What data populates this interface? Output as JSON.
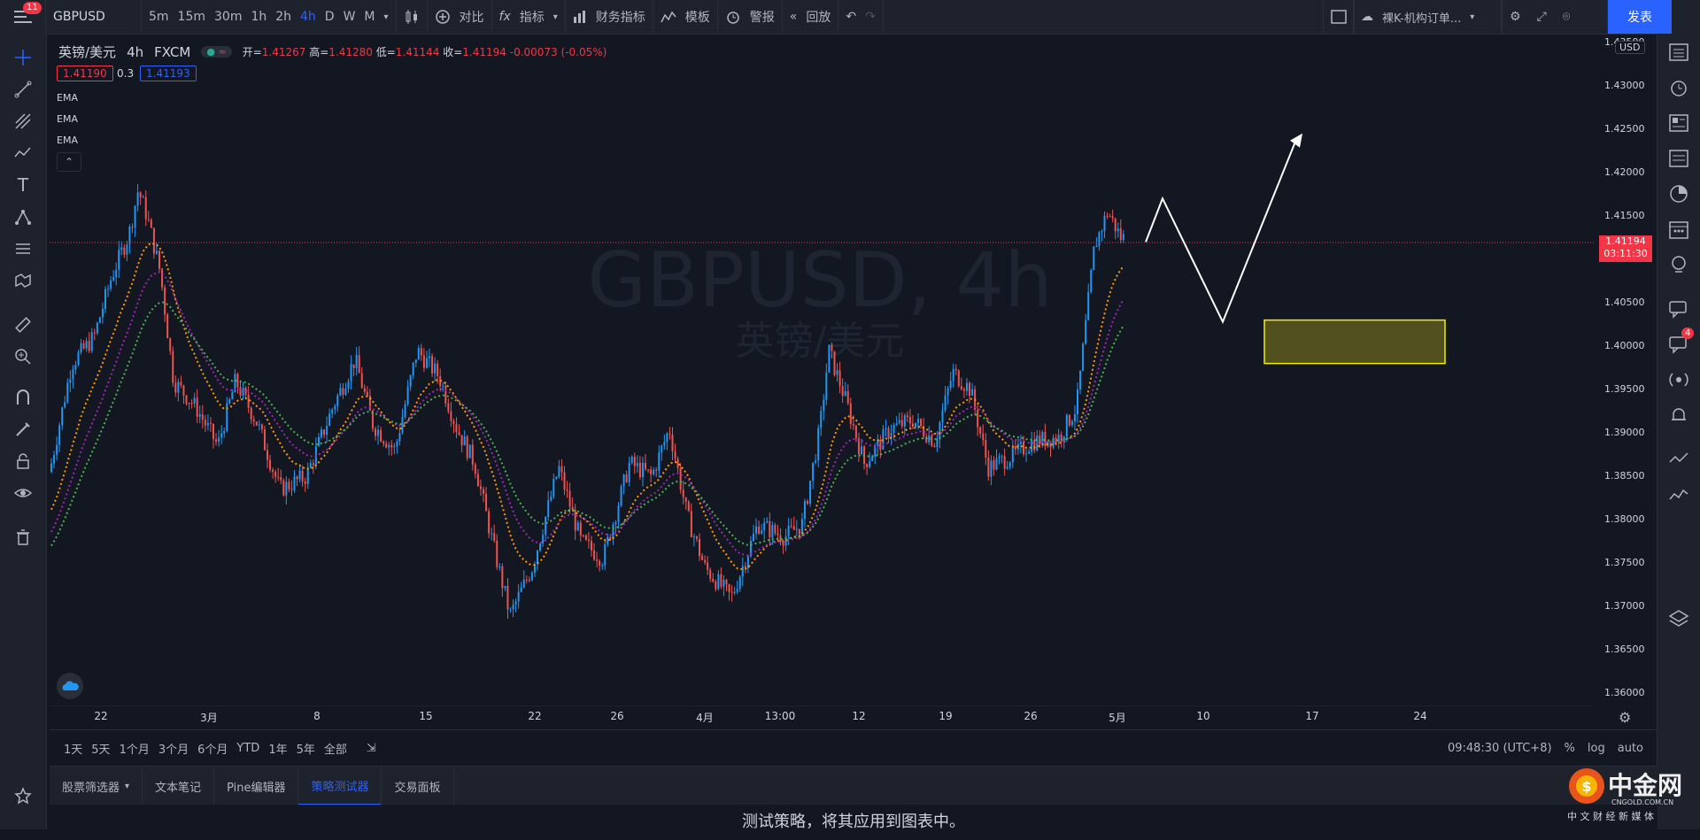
{
  "toolbar": {
    "menu_badge": "11",
    "symbol": "GBPUSD",
    "intervals": [
      "5m",
      "15m",
      "30m",
      "1h",
      "2h",
      "4h",
      "D",
      "W",
      "M"
    ],
    "active_interval": "4h",
    "compare_label": "对比",
    "indicators_label": "指标",
    "financials_label": "财务指标",
    "templates_label": "模板",
    "alert_label": "警报",
    "replay_label": "回放",
    "layout_name": "裸K-机构订单...",
    "publish_label": "发表"
  },
  "legend": {
    "pair_name": "英镑/美元",
    "interval": "4h",
    "broker": "FXCM",
    "open_label": "开=",
    "open": "1.41267",
    "high_label": "高=",
    "high": "1.41280",
    "low_label": "低=",
    "low": "1.41144",
    "close_label": "收=",
    "close": "1.41194",
    "change": "-0.00073 (-0.05%)",
    "bid": "1.41190",
    "spread": "0.3",
    "ask": "1.41193",
    "ema_labels": [
      "EMA",
      "EMA",
      "EMA"
    ]
  },
  "watermark": {
    "title": "GBPUSD, 4h",
    "subtitle": "英镑/美元"
  },
  "price_axis": {
    "currency": "USD",
    "labels": [
      "1.43500",
      "1.43000",
      "1.42500",
      "1.42000",
      "1.41500",
      "1.41000",
      "1.40500",
      "1.40000",
      "1.39500",
      "1.39000",
      "1.38500",
      "1.38000",
      "1.37500",
      "1.37000",
      "1.36500",
      "1.36000"
    ],
    "last_price": "1.41194",
    "countdown": "03:11:30"
  },
  "time_axis": {
    "labels": [
      "22",
      "3月",
      "8",
      "15",
      "22",
      "26",
      "4月",
      "13:00",
      "12",
      "19",
      "26",
      "5月",
      "10",
      "17",
      "24"
    ]
  },
  "range_bar": {
    "ranges": [
      "1天",
      "5天",
      "1个月",
      "3个月",
      "6个月",
      "YTD",
      "1年",
      "5年",
      "全部"
    ],
    "clock": "09:48:30 (UTC+8)",
    "percent_label": "%",
    "log_label": "log",
    "auto_label": "auto"
  },
  "bottom_tabs": {
    "tabs": [
      "股票筛选器",
      "文本笔记",
      "Pine编辑器",
      "策略测试器",
      "交易面板"
    ],
    "active": "策略测试器",
    "message": "测试策略，将其应用到图表中。"
  },
  "right_panel": {
    "chat_badge": "4"
  },
  "brand": {
    "name": "中金网",
    "domain": "CNGOLD.COM.CN",
    "slogan": "中 文 财 经 新 媒 体"
  },
  "colors": {
    "bg": "#131722",
    "up": "#2196f3",
    "down": "#ef5350",
    "ema_fast": "#ff9800",
    "ema_mid": "#9c27b0",
    "ema_slow": "#4caf50",
    "zone_fill": "#5f5a1e",
    "zone_border": "#f5eb00",
    "accent": "#2962ff"
  }
}
